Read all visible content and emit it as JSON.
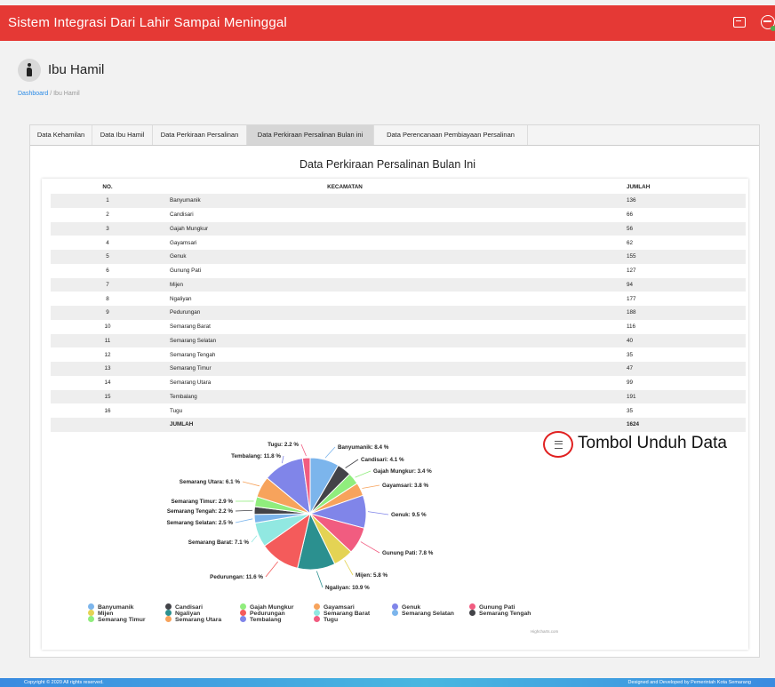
{
  "app": {
    "title": "Sistem Integrasi Dari Lahir Sampai Meninggal"
  },
  "header": {
    "page_title": "Ibu Hamil"
  },
  "breadcrumb": {
    "home": "Dashboard",
    "separator": "/",
    "current": "Ibu Hamil"
  },
  "tabs": [
    {
      "label": "Data Kehamilan"
    },
    {
      "label": "Data Ibu Hamil"
    },
    {
      "label": "Data Perkiraan Persalinan"
    },
    {
      "label": "Data Perkiraan Persalinan Bulan ini",
      "active": true
    },
    {
      "label": "Data Perencanaan Pembiayaan Persalinan"
    }
  ],
  "table": {
    "title": "Data Perkiraan Persalinan Bulan Ini",
    "headers": {
      "no": "NO.",
      "kecamatan": "KECAMATAN",
      "jumlah": "JUMLAH"
    },
    "rows": [
      {
        "no": "1",
        "kecamatan": "Banyumanik",
        "jumlah": "136"
      },
      {
        "no": "2",
        "kecamatan": "Candisari",
        "jumlah": "66"
      },
      {
        "no": "3",
        "kecamatan": "Gajah Mungkur",
        "jumlah": "56"
      },
      {
        "no": "4",
        "kecamatan": "Gayamsari",
        "jumlah": "62"
      },
      {
        "no": "5",
        "kecamatan": "Genuk",
        "jumlah": "155"
      },
      {
        "no": "6",
        "kecamatan": "Gunung Pati",
        "jumlah": "127"
      },
      {
        "no": "7",
        "kecamatan": "Mijen",
        "jumlah": "94"
      },
      {
        "no": "8",
        "kecamatan": "Ngaliyan",
        "jumlah": "177"
      },
      {
        "no": "9",
        "kecamatan": "Pedurungan",
        "jumlah": "188"
      },
      {
        "no": "10",
        "kecamatan": "Semarang Barat",
        "jumlah": "116"
      },
      {
        "no": "11",
        "kecamatan": "Semarang Selatan",
        "jumlah": "40"
      },
      {
        "no": "12",
        "kecamatan": "Semarang Tengah",
        "jumlah": "35"
      },
      {
        "no": "13",
        "kecamatan": "Semarang Timur",
        "jumlah": "47"
      },
      {
        "no": "14",
        "kecamatan": "Semarang Utara",
        "jumlah": "99"
      },
      {
        "no": "15",
        "kecamatan": "Tembalang",
        "jumlah": "191"
      },
      {
        "no": "16",
        "kecamatan": "Tugu",
        "jumlah": "35"
      }
    ],
    "total": {
      "label": "JUMLAH",
      "value": "1624"
    }
  },
  "chart_data": {
    "type": "pie",
    "series": [
      {
        "name": "Banyumanik",
        "percent": 8.4,
        "label": "Banyumanik: 8.4 %",
        "color": "#7cb5ec"
      },
      {
        "name": "Candisari",
        "percent": 4.1,
        "label": "Candisari: 4.1 %",
        "color": "#434348"
      },
      {
        "name": "Gajah Mungkur",
        "percent": 3.4,
        "label": "Gajah Mungkur: 3.4 %",
        "color": "#90ed7d"
      },
      {
        "name": "Gayamsari",
        "percent": 3.8,
        "label": "Gayamsari: 3.8 %",
        "color": "#f7a35c"
      },
      {
        "name": "Genuk",
        "percent": 9.5,
        "label": "Genuk: 9.5 %",
        "color": "#8085e9"
      },
      {
        "name": "Gunung Pati",
        "percent": 7.8,
        "label": "Gunung Pati: 7.8 %",
        "color": "#f15c80"
      },
      {
        "name": "Mijen",
        "percent": 5.8,
        "label": "Mijen: 5.8 %",
        "color": "#e4d354"
      },
      {
        "name": "Ngaliyan",
        "percent": 10.9,
        "label": "Ngaliyan: 10.9 %",
        "color": "#2b908f"
      },
      {
        "name": "Pedurungan",
        "percent": 11.6,
        "label": "Pedurungan: 11.6 %",
        "color": "#f45b5b"
      },
      {
        "name": "Semarang Barat",
        "percent": 7.1,
        "label": "Semarang Barat: 7.1 %",
        "color": "#91e8e1"
      },
      {
        "name": "Semarang Selatan",
        "percent": 2.5,
        "label": "Semarang Selatan: 2.5 %",
        "color": "#7cb5ec"
      },
      {
        "name": "Semarang Tengah",
        "percent": 2.2,
        "label": "Semarang Tengah: 2.2 %",
        "color": "#434348"
      },
      {
        "name": "Semarang Timur",
        "percent": 2.9,
        "label": "Semarang Timur: 2.9 %",
        "color": "#90ed7d"
      },
      {
        "name": "Semarang Utara",
        "percent": 6.1,
        "label": "Semarang Utara: 6.1 %",
        "color": "#f7a35c"
      },
      {
        "name": "Tembalang",
        "percent": 11.8,
        "label": "Tembalang: 11.8 %",
        "color": "#8085e9"
      },
      {
        "name": "Tugu",
        "percent": 2.2,
        "label": "Tugu: 2.2 %",
        "color": "#f15c80"
      }
    ],
    "legend_position": "bottom",
    "credits": "Highcharts.com"
  },
  "annotation": {
    "text": "Tombol Unduh Data"
  },
  "footer": {
    "left": "Copyright © 2020 All rights reserved.",
    "right": "Designed and Developed by Pemerintah Kota Semarang"
  }
}
